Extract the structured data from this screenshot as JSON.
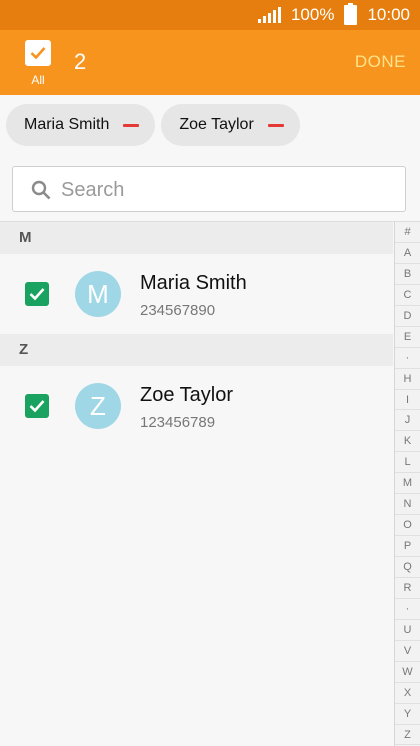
{
  "status": {
    "battery": "100%",
    "time": "10:00"
  },
  "action_bar": {
    "select_all_label": "All",
    "selected_count": "2",
    "done_label": "DONE"
  },
  "chips": [
    {
      "label": "Maria Smith"
    },
    {
      "label": "Zoe Taylor"
    }
  ],
  "search": {
    "placeholder": "Search"
  },
  "sections": [
    {
      "letter": "M",
      "contact": {
        "initial": "M",
        "name": "Maria Smith",
        "number": "234567890",
        "checked": true
      }
    },
    {
      "letter": "Z",
      "contact": {
        "initial": "Z",
        "name": "Zoe Taylor",
        "number": "123456789",
        "checked": true
      }
    }
  ],
  "index": [
    "#",
    "A",
    "B",
    "C",
    "D",
    "E",
    "·",
    "H",
    "I",
    "J",
    "K",
    "L",
    "M",
    "N",
    "O",
    "P",
    "Q",
    "R",
    "·",
    "U",
    "V",
    "W",
    "X",
    "Y",
    "Z"
  ],
  "colors": {
    "status_bar": "#e57e0e",
    "action_bar": "#f7941d",
    "done_text": "#ffe38a",
    "checkbox": "#1aa260",
    "avatar": "#9fd7e6",
    "remove": "#e53935"
  }
}
